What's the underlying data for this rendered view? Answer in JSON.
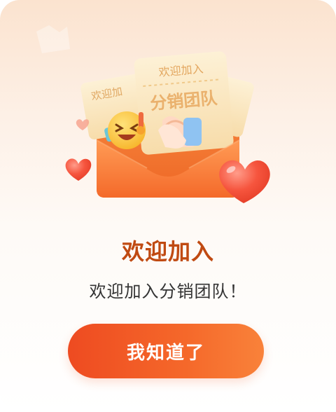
{
  "illustration": {
    "ticket_small_text": "欢迎加",
    "ticket_top_text": "欢迎加入",
    "ticket_main_text": "分销团队",
    "colors": {
      "envelope": "#f7863e",
      "envelope_dark": "#ee5f22",
      "ticket": "#fbe9c4",
      "heart": "#f04a33"
    }
  },
  "dialog": {
    "title": "欢迎加入",
    "message": "欢迎加入分销团队！",
    "confirm_label": "我知道了"
  },
  "colors": {
    "title": "#c04a12",
    "button": "#f05a28"
  }
}
